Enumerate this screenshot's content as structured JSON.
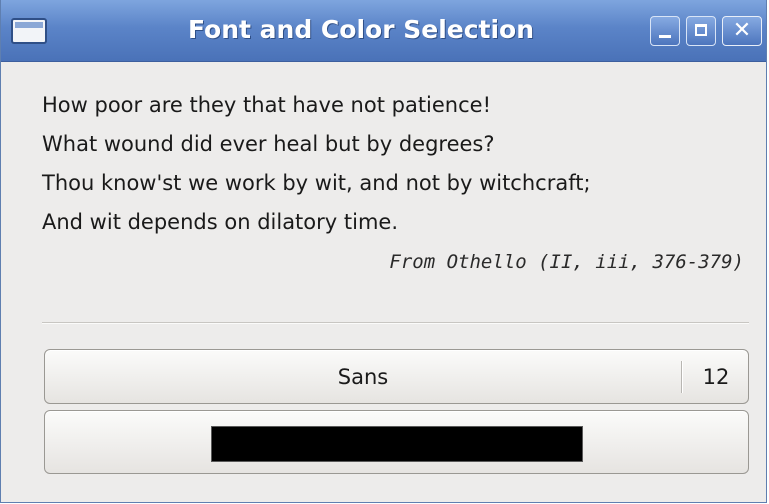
{
  "window": {
    "title": "Font and Color Selection",
    "app_icon": "window-icon",
    "controls": {
      "minimize_icon": "minimize-icon",
      "maximize_icon": "maximize-icon",
      "close_icon": "close-icon",
      "close_glyph": "✕"
    }
  },
  "quote": {
    "lines": [
      "How poor are they that have not patience!",
      "What wound did ever heal but by degrees?",
      "Thou know'st we work by wit, and not by witchcraft;",
      "And wit depends on dilatory time."
    ],
    "attribution": "From Othello (II, iii, 376-379)"
  },
  "font_button": {
    "font_name": "Sans",
    "font_size": "12"
  },
  "color_button": {
    "color": "#000000"
  },
  "colors": {
    "titlebar": "#5b84c8",
    "window_bg": "#edeceb",
    "text": "#1a1a1a"
  }
}
